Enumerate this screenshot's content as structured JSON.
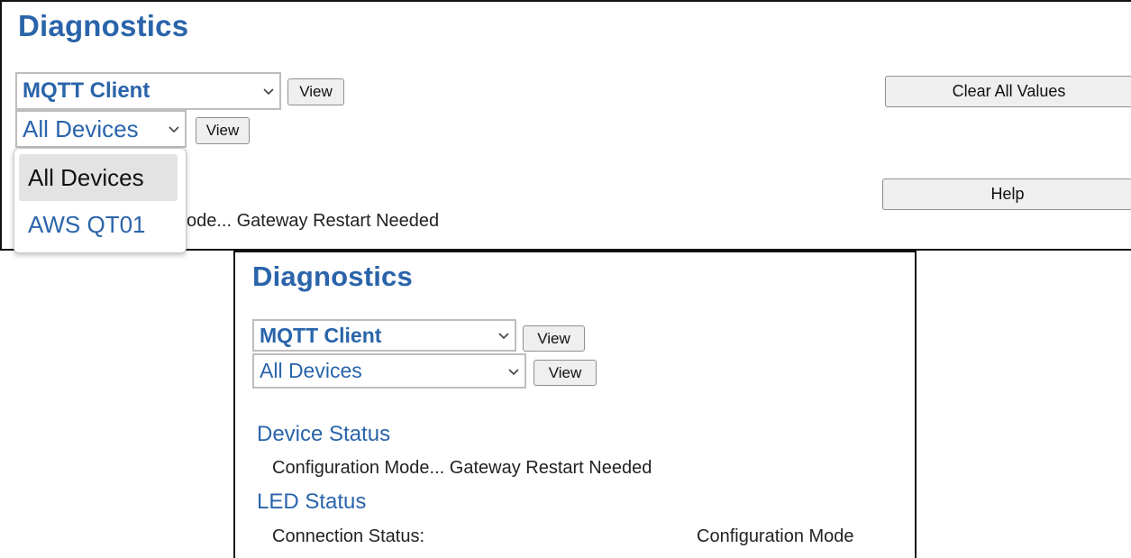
{
  "top": {
    "title": "Diagnostics",
    "protocol_select": "MQTT Client",
    "view_label": "View",
    "device_select": "All Devices",
    "device_view_label": "View",
    "clear_label": "Clear All Values",
    "help_label": "Help",
    "dropdown": {
      "options": [
        {
          "label": "All Devices",
          "selected": true
        },
        {
          "label": "AWS QT01",
          "selected": false
        }
      ]
    },
    "status_fragment": "ode... Gateway Restart Needed"
  },
  "bottom": {
    "title": "Diagnostics",
    "protocol_select": "MQTT Client",
    "view_label": "View",
    "device_select": "All Devices",
    "device_view_label": "View",
    "device_status_heading": "Device Status",
    "device_status_text": "Configuration Mode... Gateway Restart Needed",
    "led_status_heading": "LED Status",
    "connection_label": "Connection Status:",
    "connection_value": "Configuration Mode"
  },
  "colors": {
    "accent": "#2a64aa",
    "text": "#222222",
    "border": "#111111"
  },
  "icons": [
    "chevron-down-icon"
  ]
}
